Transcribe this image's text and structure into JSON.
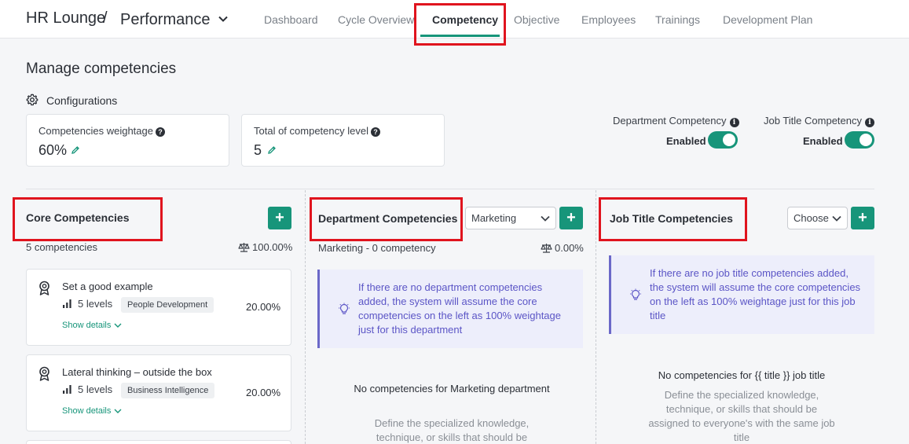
{
  "app": {
    "name": "HR Lounge",
    "separator": "/",
    "module": "Performance"
  },
  "nav": {
    "tabs": [
      {
        "label": "Dashboard"
      },
      {
        "label": "Cycle Overview"
      },
      {
        "label": "Competency"
      },
      {
        "label": "Objective"
      },
      {
        "label": "Employees"
      },
      {
        "label": "Trainings"
      },
      {
        "label": "Development Plan"
      }
    ],
    "active_tab": "Competency"
  },
  "page": {
    "title": "Manage competencies",
    "config_label": "Configurations"
  },
  "config": {
    "weightage": {
      "label": "Competencies weightage",
      "value": "60%"
    },
    "levels": {
      "label": "Total of competency level",
      "value": "5"
    },
    "department_toggle": {
      "label": "Department Competency",
      "state": "Enabled"
    },
    "job_title_toggle": {
      "label": "Job Title Competency",
      "state": "Enabled"
    }
  },
  "core": {
    "title": "Core Competencies",
    "count": "5 competencies",
    "weight": "100.00%",
    "items": [
      {
        "name": "Set a good example",
        "levels": "5 levels",
        "tag": "People Development",
        "pct": "20.00%",
        "details": "Show details"
      },
      {
        "name": "Lateral thinking – outside the box",
        "levels": "5 levels",
        "tag": "Business Intelligence",
        "pct": "20.00%",
        "details": "Show details"
      }
    ]
  },
  "department": {
    "title": "Department Competencies",
    "selected": "Marketing",
    "count": "Marketing - 0 competency",
    "weight": "0.00%",
    "info": "If there are no department competencies added, the system will assume the core competencies on the left as 100% weightage just for this department",
    "empty_title": "No competencies for Marketing department",
    "empty_desc": "Define the specialized knowledge, technique, or skills that should be"
  },
  "job_title": {
    "title": "Job Title Competencies",
    "selected": "Choose",
    "info": "If there are no job title competencies added, the system will assume the core competencies on the left as 100% weightage just for this job title",
    "empty_title": "No competencies for {{ title }} job title",
    "empty_desc": "Define the specialized knowledge, technique, or skills that should be assigned to everyone's with the same job title"
  },
  "add_label": "+",
  "colors": {
    "accent": "#17957a",
    "info_text": "#5b55c6",
    "info_bg": "#edeefb",
    "highlight": "#e0141e"
  }
}
